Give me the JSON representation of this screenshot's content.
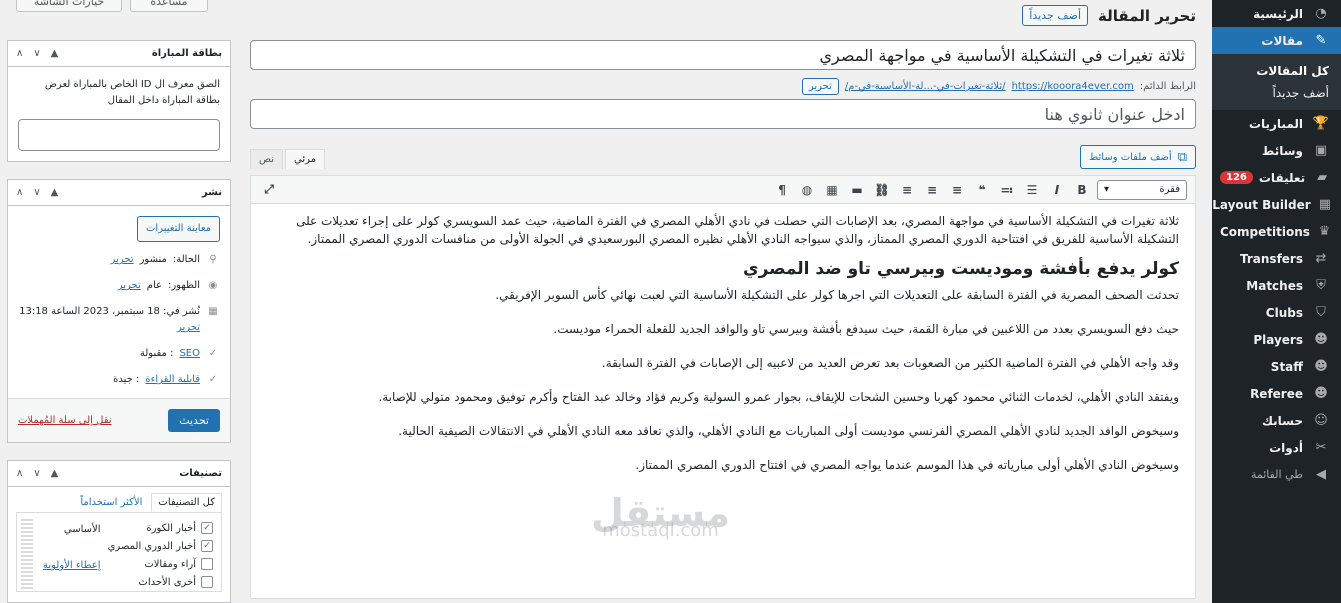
{
  "admin_menu": {
    "items": [
      {
        "label": "الرئيسية",
        "icon": "dashboard-icon",
        "glyph": "◔"
      },
      {
        "label": "مقالات",
        "icon": "pin-icon",
        "glyph": "✎",
        "current": true
      },
      {
        "label": "المباريات",
        "icon": "trophy-icon",
        "glyph": "🏆"
      },
      {
        "label": "وسائط",
        "icon": "media-icon",
        "glyph": "▣"
      },
      {
        "label": "تعليقات",
        "icon": "comment-icon",
        "glyph": "▰",
        "badge": "126"
      },
      {
        "label": "Layout Builder",
        "icon": "layout-icon",
        "glyph": "▦"
      },
      {
        "label": "Competitions",
        "icon": "trophy-icon",
        "glyph": "♛"
      },
      {
        "label": "Transfers",
        "icon": "transfer-icon",
        "glyph": "⇄"
      },
      {
        "label": "Matches",
        "icon": "shield-icon",
        "glyph": "⛨"
      },
      {
        "label": "Clubs",
        "icon": "shield-icon",
        "glyph": "⛉"
      },
      {
        "label": "Players",
        "icon": "people-icon",
        "glyph": "☻"
      },
      {
        "label": "Staff",
        "icon": "people-icon",
        "glyph": "☻"
      },
      {
        "label": "Referee",
        "icon": "people-icon",
        "glyph": "☻"
      },
      {
        "label": "حسابك",
        "icon": "user-icon",
        "glyph": "☺"
      },
      {
        "label": "أدوات",
        "icon": "wrench-icon",
        "glyph": "✂"
      },
      {
        "label": "طي القائمة",
        "icon": "collapse-icon",
        "glyph": "◀"
      }
    ],
    "submenu": [
      "كل المقالات",
      "أضف جديداً"
    ]
  },
  "header": {
    "title": "تحرير المقالة",
    "add_new": "أضف جديداً",
    "screen_options": "خيارات الشاشة",
    "help": "مساعدة"
  },
  "post": {
    "title": "ثلاثة تغيرات في التشكيلة الأساسية في مواجهة المصري",
    "permalink_label": "الرابط الدائم:",
    "permalink_base": "https://kooora4ever.com",
    "permalink_slug": "/ثلاثة-تغيرات-في-...لة-الأساسية-في-م/",
    "permalink_edit": "تحرير",
    "subtitle_placeholder": "ادخل عنوان ثانوي هنا"
  },
  "editor": {
    "add_media": "أضف ملفات وسائط",
    "tab_visual": "مرئي",
    "tab_text": "نص",
    "format": "فقرة",
    "p1": "ثلاثة تغيرات في التشكيلة الأساسية في مواجهة المصري، بعد الإصابات التي حصلت في نادي الأهلي المصري في الفترة الماضية، حيث عمد السويسري كولر على إجراء تعديلات على التشكيلة الأساسية للفريق في افتتاحية الدوري المصري الممتاز، والذي سيواجه النادي الأهلي نظيره المصري البورسعيدي في الجولة الأولى من منافسات الدوري المصري الممتاز.",
    "h2": "كولر يدفع بأفشة وموديست وبيرسي تاو ضد المصري",
    "p2": "تحدثت الصحف المصرية في الفترة السابقة على التعديلات التي اجرها كولر على التشكيلة الأساسية التي لعبت نهائي كأس السوبر الإفريقي.",
    "p3": "حيث دفع السويسري بعدد من اللاعبين في مبارة القمة، حيث سيدفع بأفشة وبيرسي تاو والوافد الجديد للقعلة الحمراء موديست.",
    "p4": "وقد واجه الأهلي في الفترة الماضية الكثير من الصعوبات بعد تعرض العديد من لاعبيه إلى الإصابات في الفترة السابقة.",
    "p5": "ويفتقد النادي الأهلي، لخدمات الثنائي محمود كهربا وحسين الشحات للإيقاف، بجوار عمرو السولية وكريم فؤاد وخالد عبد الفتاح وأكرم توفيق ومحمود متولي للإصابة.",
    "p6": "وسيخوض الوافد الجديد لنادي الأهلي المصري الفرنسي موديست أولى المباريات مع النادي الأهلي، والذي تعاقد معه النادي الأهلي في الانتقالات الصيفية الحالية.",
    "p7": "وسيخوض النادي الأهلي أولى مبارياته في هذا الموسم عندما يواجه المصري في افتتاح الدوري المصري الممتاز.",
    "watermark_ar": "مستقل",
    "watermark_en": "mostaql.com"
  },
  "match_box": {
    "title": "بطاقة المباراة",
    "help": "الصق معرف ال ID الخاص بالمباراة لعرض بطاقة المباراة داخل المقال"
  },
  "publish_box": {
    "title": "نشر",
    "preview": "معاينة التغييرات",
    "status_label": "الحالة:",
    "status_value": "منشور",
    "visibility_label": "الظهور:",
    "visibility_value": "عام",
    "published_label": "نُشر في:",
    "published_value": "18 سبتمبر، 2023 الساعة 13:18",
    "edit": "تحرير",
    "seo_label": "SEO",
    "seo_value": ": مقبولة",
    "readability_label": "قابلية القراءة",
    "readability_value": ": جيدة",
    "trash": "نقل إلى سلة المُهملات",
    "update": "تحديث"
  },
  "categories_box": {
    "title": "تصنيفات",
    "tab_all": "كل التصنيفات",
    "tab_popular": "الأكثر استخداماً",
    "items": [
      {
        "label": "أخبار الكورة",
        "checked": true
      },
      {
        "label": "أخبار الدوري المصري",
        "checked": true
      },
      {
        "label": "آراء ومقالات",
        "checked": false
      },
      {
        "label": "أخرى الأحداث",
        "checked": false
      }
    ],
    "primary_label": "الأساسي",
    "make_primary": "إعطاء الأولوية"
  },
  "colors": {
    "accent": "#2271b1",
    "sidebar": "#1d2327",
    "badge": "#d63638"
  }
}
